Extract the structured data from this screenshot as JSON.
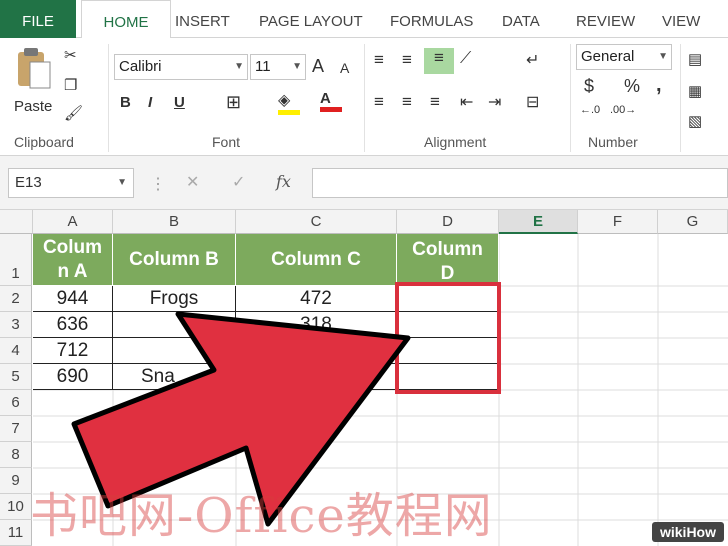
{
  "tabs": [
    "FILE",
    "HOME",
    "INSERT",
    "PAGE LAYOUT",
    "FORMULAS",
    "DATA",
    "REVIEW",
    "VIEW"
  ],
  "ribbon": {
    "paste_label": "Paste",
    "clipboard_label": "Clipboard",
    "font_name": "Calibri",
    "font_size": "11",
    "font_label": "Font",
    "alignment_label": "Alignment",
    "number_format": "General",
    "number_label": "Number",
    "bold": "B",
    "italic": "I",
    "underline": "U",
    "grow_font": "A",
    "shrink_font": "A",
    "currency": "$",
    "percent": "%",
    "comma": ","
  },
  "formula_bar": {
    "name_box": "E13",
    "fx": "fx",
    "formula": ""
  },
  "grid": {
    "columns": [
      "A",
      "B",
      "C",
      "D",
      "E",
      "F",
      "G"
    ],
    "rows": [
      "1",
      "2",
      "3",
      "4",
      "5",
      "6",
      "7",
      "8",
      "9",
      "10",
      "11"
    ],
    "header_cells": [
      "Colum\nn A",
      "Column B",
      "Column C",
      "Column\nD"
    ],
    "data": [
      [
        "944",
        "Frogs",
        "472"
      ],
      [
        "636",
        "",
        "318"
      ],
      [
        "712",
        "",
        "",
        ""
      ],
      [
        "690",
        "Sna",
        "",
        ""
      ]
    ]
  },
  "watermark": "书吧网-Office教程网",
  "wikihow": "wikiHow",
  "colors": {
    "accent": "#217346",
    "header_fill": "#7daa5d",
    "arrow": "#e03040",
    "highlight": "#e03040"
  }
}
